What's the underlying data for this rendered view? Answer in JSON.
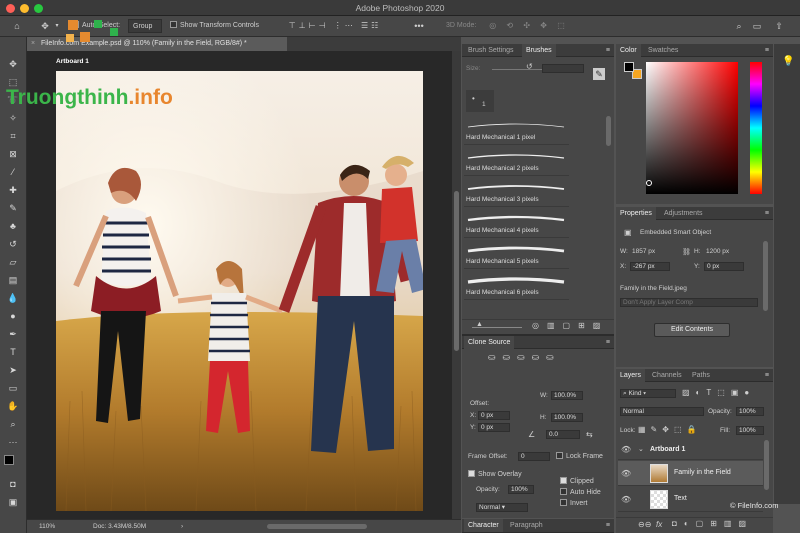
{
  "app_title": "Adobe Photoshop 2020",
  "options": {
    "auto_select": "Auto-Select:",
    "group": "Group",
    "show_transform": "Show Transform Controls",
    "mode_3d": "3D Mode:",
    "dots": "•••"
  },
  "document": {
    "tab": "FileInfo.com Example.psd @ 110% (Family in the Field, RGB/8#) *",
    "artboard": "Artboard 1",
    "zoom": "110%",
    "doc_size": "Doc: 3.43M/8.50M"
  },
  "watermark": {
    "part1": "Truongthinh",
    "part2": ".info",
    "fileinfo": "© FileInfo.com"
  },
  "brushes": {
    "tabs": [
      "Brush Settings",
      "Brushes"
    ],
    "size_label": "Size:",
    "size_value": "1",
    "items": [
      "Hard Mechanical 1 pixel",
      "Hard Mechanical 2 pixels",
      "Hard Mechanical 3 pixels",
      "Hard Mechanical 4 pixels",
      "Hard Mechanical 5 pixels",
      "Hard Mechanical 6 pixels"
    ]
  },
  "clone": {
    "tab": "Clone Source",
    "offset": "Offset:",
    "x": "X:",
    "x_val": "0 px",
    "y": "Y:",
    "y_val": "0 px",
    "w": "W:",
    "w_val": "100.0%",
    "h": "H:",
    "h_val": "100.0%",
    "angle": "0.0",
    "frame_offset": "Frame Offset:",
    "frame_val": "0",
    "lock_frame": "Lock Frame",
    "show_overlay": "Show Overlay",
    "opacity": "Opacity:",
    "opacity_val": "100%",
    "blend": "Normal",
    "clipped": "Clipped",
    "auto_hide": "Auto Hide",
    "invert": "Invert"
  },
  "bottom_tabs": [
    "Character",
    "Paragraph"
  ],
  "color": {
    "tabs": [
      "Color",
      "Swatches"
    ],
    "fg": "#000000",
    "bg": "#f5a623"
  },
  "properties": {
    "tabs": [
      "Properties",
      "Adjustments"
    ],
    "type": "Embedded Smart Object",
    "w": "W:",
    "w_val": "1857 px",
    "h": "H:",
    "h_val": "1200 px",
    "x": "X:",
    "x_val": "-267 px",
    "y": "Y:",
    "y_val": "0 px",
    "file": "Family in the Field.jpeg",
    "layer_comp": "Don't Apply Layer Comp",
    "edit_btn": "Edit Contents"
  },
  "layers": {
    "tabs": [
      "Layers",
      "Channels",
      "Paths"
    ],
    "kind": "Kind",
    "blend": "Normal",
    "opacity_label": "Opacity:",
    "opacity": "100%",
    "lock": "Lock:",
    "fill_label": "Fill:",
    "fill": "100%",
    "artboard": "Artboard 1",
    "items": [
      "Family in the Field",
      "Text"
    ],
    "fx": "fx"
  }
}
